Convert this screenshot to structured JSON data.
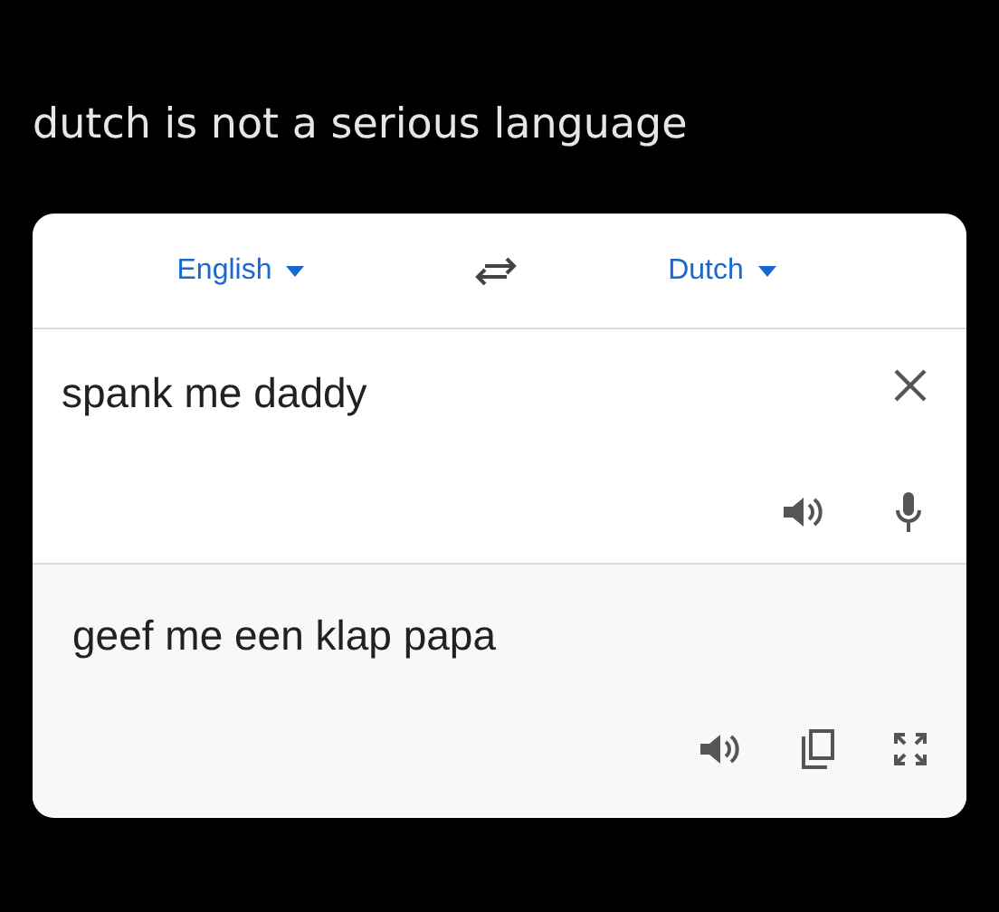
{
  "caption": "dutch is not a serious language",
  "translator": {
    "source_language": "English",
    "target_language": "Dutch",
    "input_text": "spank me daddy",
    "output_text": "geef me een klap papa"
  }
}
